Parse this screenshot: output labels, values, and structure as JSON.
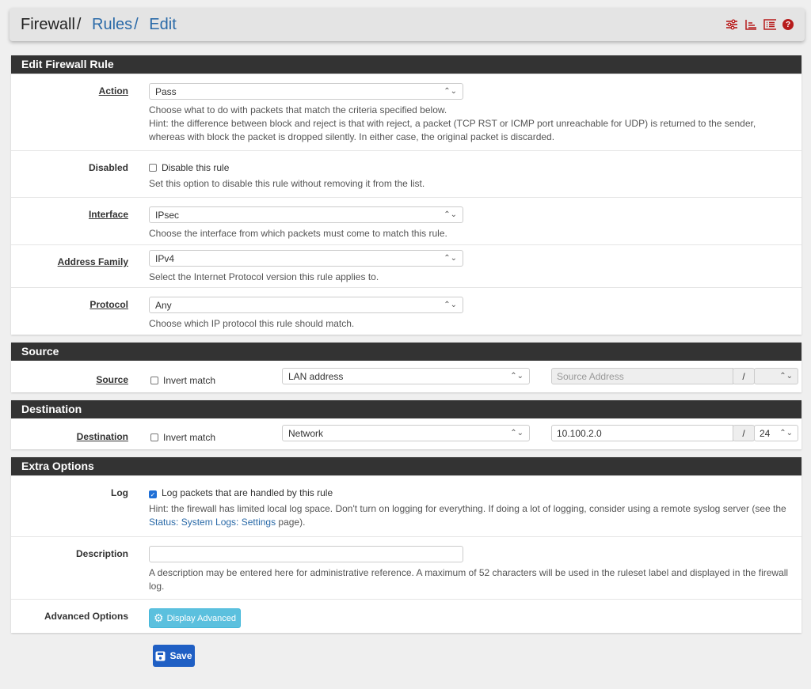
{
  "breadcrumb": {
    "root": "Firewall",
    "rules": "Rules",
    "edit": "Edit"
  },
  "header_icons": [
    "sliders-icon",
    "chart-icon",
    "list-icon",
    "help-icon"
  ],
  "sections": {
    "edit": "Edit Firewall Rule",
    "source": "Source",
    "destination": "Destination",
    "extra": "Extra Options"
  },
  "action": {
    "label": "Action",
    "value": "Pass",
    "help1": "Choose what to do with packets that match the criteria specified below.",
    "help2": "Hint: the difference between block and reject is that with reject, a packet (TCP RST or ICMP port unreachable for UDP) is returned to the sender, whereas with block the packet is dropped silently. In either case, the original packet is discarded."
  },
  "disabled": {
    "label": "Disabled",
    "checkbox": "Disable this rule",
    "help": "Set this option to disable this rule without removing it from the list."
  },
  "interface": {
    "label": "Interface",
    "value": "IPsec",
    "help": "Choose the interface from which packets must come to match this rule."
  },
  "family": {
    "label": "Address Family",
    "value": "IPv4",
    "help": "Select the Internet Protocol version this rule applies to."
  },
  "protocol": {
    "label": "Protocol",
    "value": "Any",
    "help": "Choose which IP protocol this rule should match."
  },
  "source": {
    "label": "Source",
    "invert": "Invert match",
    "type": "LAN address",
    "address_placeholder": "Source Address",
    "slash": "/",
    "mask": ""
  },
  "destination": {
    "label": "Destination",
    "invert": "Invert match",
    "type": "Network",
    "address": "10.100.2.0",
    "slash": "/",
    "mask": "24"
  },
  "log": {
    "label": "Log",
    "checkbox": "Log packets that are handled by this rule",
    "checked": true,
    "help_pre": "Hint: the firewall has limited local log space. Don't turn on logging for everything. If doing a lot of logging, consider using a remote syslog server (see the ",
    "help_link": "Status: System Logs: Settings",
    "help_post": " page)."
  },
  "description": {
    "label": "Description",
    "value": "",
    "help": "A description may be entered here for administrative reference. A maximum of 52 characters will be used in the ruleset label and displayed in the firewall log."
  },
  "advanced": {
    "label": "Advanced Options",
    "button": "Display Advanced"
  },
  "save": "Save"
}
